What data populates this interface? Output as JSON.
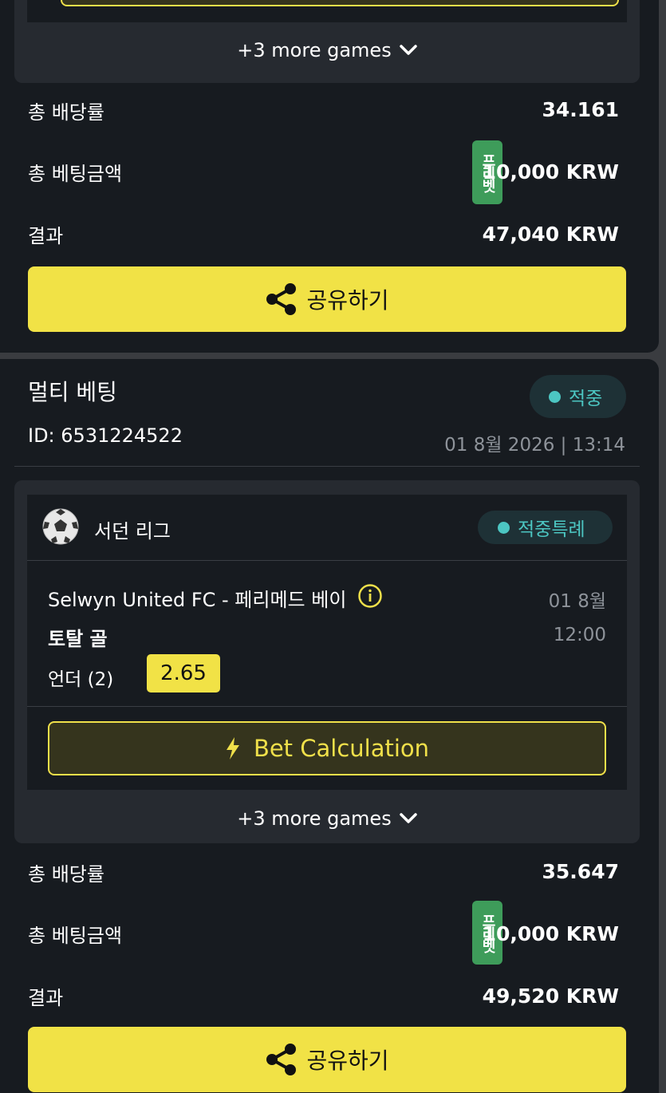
{
  "bet1": {
    "more_games": "+3 more games",
    "total_odds_label": "총 배당률",
    "total_odds_value": "34.161",
    "total_stake_label": "총 베팅금액",
    "free_bet_badge": "프리벳",
    "total_stake_value": "10,000 KRW",
    "result_label": "결과",
    "result_value": "47,040 KRW",
    "share_label": "공유하기"
  },
  "bet2": {
    "title": "멀티 베팅",
    "status": "적중",
    "id_text": "ID: 6531224522",
    "datetime": "01 8월 2026 | 13:14",
    "league": "서던 리그",
    "game_status": "적중특례",
    "match_name": "Selwyn United FC - 페리메드 베이",
    "match_date": "01 8월",
    "market": "토탈 골",
    "match_time": "12:00",
    "selection": "언더 (2)",
    "odds": "2.65",
    "bet_calc_label": "Bet Calculation",
    "more_games": "+3 more games",
    "total_odds_label": "총 배당률",
    "total_odds_value": "35.647",
    "total_stake_label": "총 베팅금액",
    "free_bet_badge": "프리벳",
    "total_stake_value": "10,000 KRW",
    "result_label": "결과",
    "result_value": "49,520 KRW",
    "share_label": "공유하기"
  },
  "colors": {
    "accent_yellow": "#f1e246",
    "status_teal": "#4cc6c2",
    "free_bet_green": "#3e9c5a",
    "card_bg": "#171b20"
  },
  "icons": [
    "share-icon",
    "chevron-down-icon",
    "soccer-ball-icon",
    "info-icon",
    "lightning-icon"
  ]
}
